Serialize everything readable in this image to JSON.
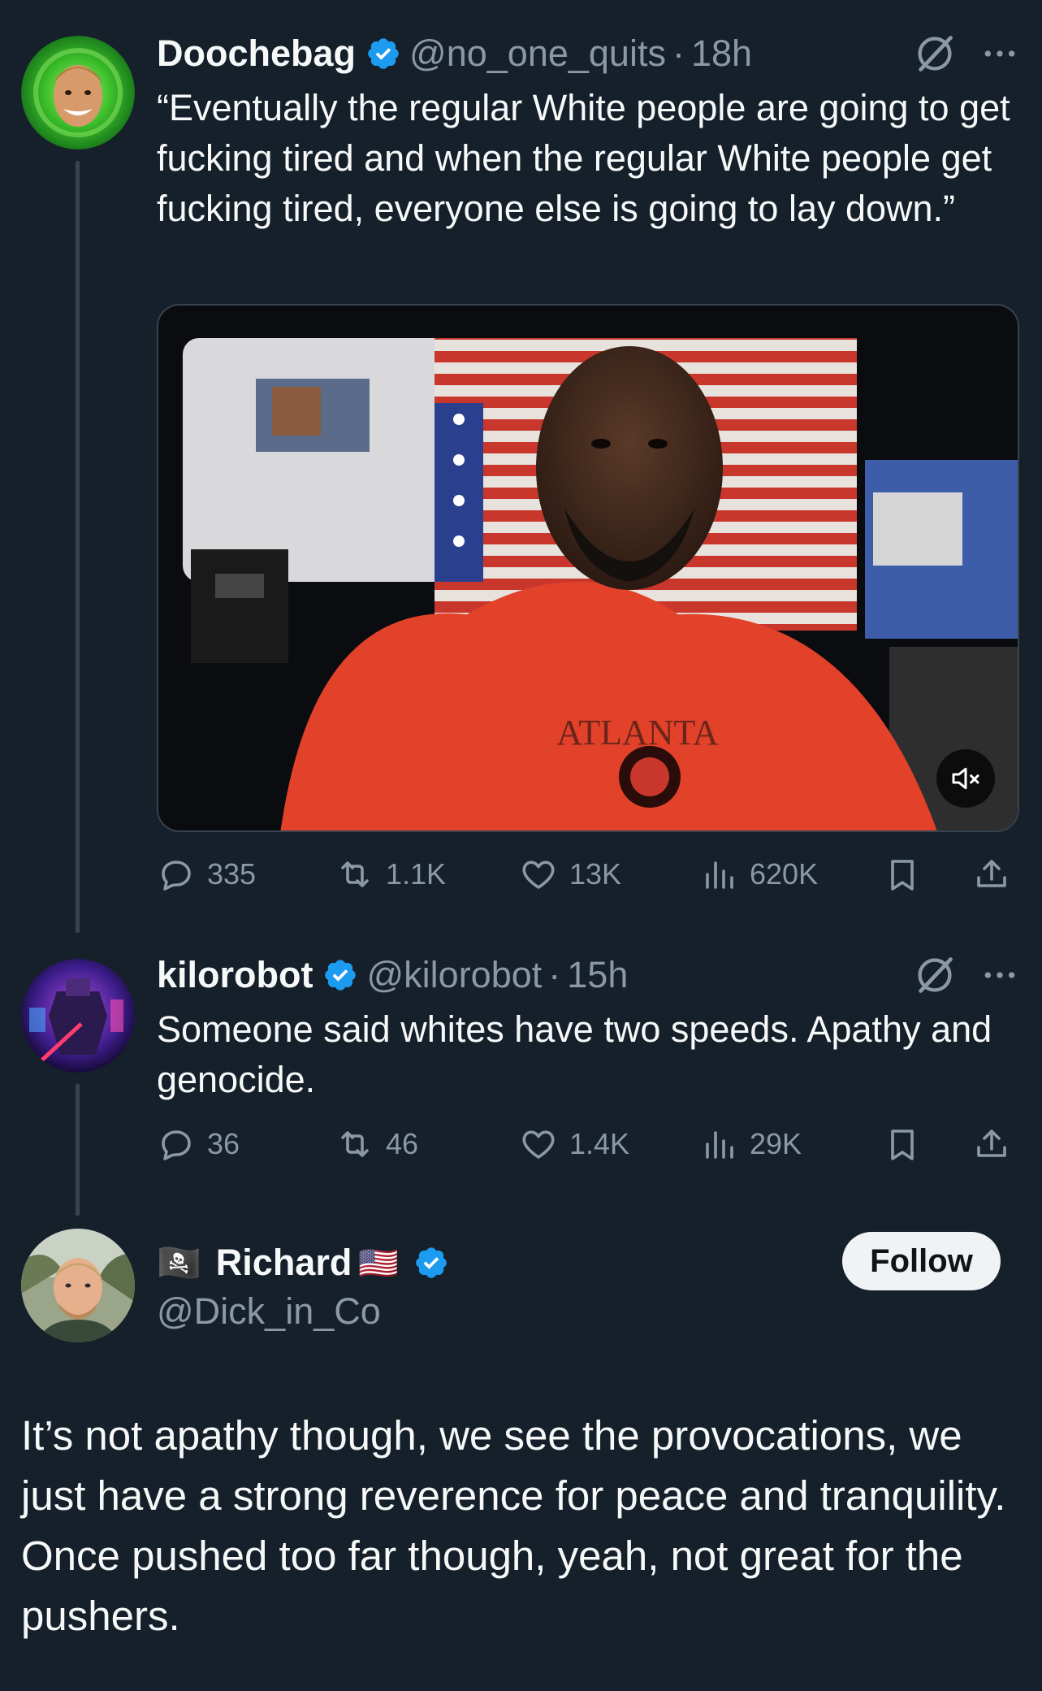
{
  "tweets": [
    {
      "name": "Doochebag",
      "handle": "@no_one_quits",
      "separator": "·",
      "time": "18h",
      "text": "“Eventually the regular White people are going to get fucking tired and when the regular White people get fucking tired, everyone else is going to lay down.”",
      "media": {
        "shirt_text": "ATLANTA",
        "muted": true
      },
      "stats": {
        "replies": "335",
        "reposts": "1.1K",
        "likes": "13K",
        "views": "620K"
      }
    },
    {
      "name": "kilorobot",
      "handle": "@kilorobot",
      "separator": "·",
      "time": "15h",
      "text": "Someone said whites have two speeds.  Apathy and genocide.",
      "stats": {
        "replies": "36",
        "reposts": "46",
        "likes": "1.4K",
        "views": "29K"
      }
    }
  ],
  "main_tweet": {
    "flag_emoji": "🏴‍☠️",
    "name": "Richard",
    "name_flag": "🇺🇸",
    "handle": "@Dick_in_Co",
    "follow_label": "Follow",
    "text": "It’s not apathy though, we see the provocations, we just have a strong reverence for peace and tranquility. Once pushed too far though, yeah, not great for the pushers."
  },
  "colors": {
    "background": "#15202b",
    "text": "#f7f9f9",
    "secondary": "#8b98a5",
    "verified": "#1d9bf0",
    "follow_bg": "#eff3f4"
  },
  "icons": [
    "verified-badge-icon",
    "grok-icon",
    "more-icon",
    "reply-icon",
    "repost-icon",
    "like-icon",
    "views-icon",
    "bookmark-icon",
    "share-icon",
    "mute-icon"
  ]
}
